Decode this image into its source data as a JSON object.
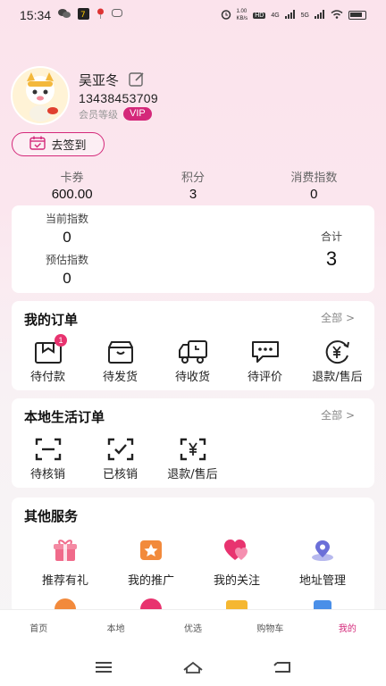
{
  "status_bar": {
    "time": "15:34",
    "speed_value": "1.00",
    "speed_unit": "KB/s",
    "network_labels": [
      "HD",
      "4G",
      "5G"
    ]
  },
  "profile": {
    "name": "吴亚冬",
    "phone": "13438453709",
    "level_label": "会员等级",
    "vip_badge": "VIP"
  },
  "signin": {
    "label": "去签到"
  },
  "stats": [
    {
      "label": "卡券",
      "value": "600.00"
    },
    {
      "label": "积分",
      "value": "3"
    },
    {
      "label": "消费指数",
      "value": "0"
    }
  ],
  "index_card": {
    "current_label": "当前指数",
    "current_value": "0",
    "estimate_label": "预估指数",
    "estimate_value": "0",
    "total_label": "合计",
    "total_value": "3"
  },
  "orders": {
    "title": "我的订单",
    "more": "全部 >",
    "items": [
      {
        "label": "待付款",
        "icon": "wallet-icon",
        "badge": "1"
      },
      {
        "label": "待发货",
        "icon": "box-icon"
      },
      {
        "label": "待收货",
        "icon": "truck-icon"
      },
      {
        "label": "待评价",
        "icon": "comment-icon"
      },
      {
        "label": "退款/售后",
        "icon": "refund-icon"
      }
    ]
  },
  "local_orders": {
    "title": "本地生活订单",
    "more": "全部 >",
    "items": [
      {
        "label": "待核销",
        "icon": "scan-icon"
      },
      {
        "label": "已核销",
        "icon": "scan-check-icon"
      },
      {
        "label": "退款/售后",
        "icon": "scan-yen-icon"
      }
    ]
  },
  "services": {
    "title": "其他服务",
    "items": [
      {
        "label": "推荐有礼",
        "icon": "gift-icon",
        "color": "#f06a8a"
      },
      {
        "label": "我的推广",
        "icon": "star-badge-icon",
        "color": "#f28a3c"
      },
      {
        "label": "我的关注",
        "icon": "heart-icon",
        "color": "#e8336f"
      },
      {
        "label": "地址管理",
        "icon": "location-icon",
        "color": "#6b6fd8"
      }
    ]
  },
  "tabs": [
    {
      "label": "首页"
    },
    {
      "label": "本地"
    },
    {
      "label": "优选"
    },
    {
      "label": "购物车"
    },
    {
      "label": "我的",
      "active": true
    }
  ],
  "colors": {
    "accent": "#d4287a",
    "badge": "#e8336f"
  }
}
